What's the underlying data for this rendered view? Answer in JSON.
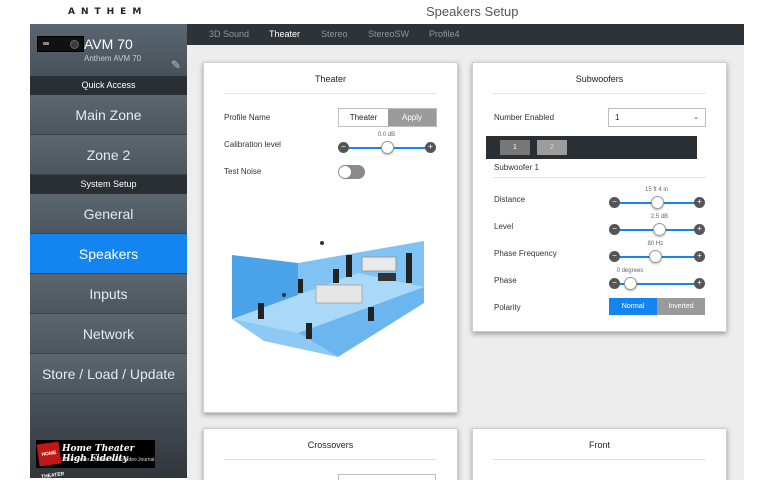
{
  "header": {
    "brand": "ANTHEM",
    "title": "Speakers Setup"
  },
  "sidebar": {
    "device_name": "AVM 70",
    "device_sub": "Anthem AVM 70",
    "quick_access_label": "Quick Access",
    "system_setup_label": "System Setup",
    "quick_items": [
      {
        "label": "Main Zone"
      },
      {
        "label": "Zone 2"
      }
    ],
    "setup_items": [
      {
        "label": "General"
      },
      {
        "label": "Speakers",
        "active": true
      },
      {
        "label": "Inputs"
      },
      {
        "label": "Network"
      },
      {
        "label": "Store / Load / Update"
      }
    ],
    "watermark": {
      "badge": "HOME THEATER",
      "title": "Home Theater High Fidelity",
      "subtitle": "The Premier On-Line Audio/Video Journal"
    }
  },
  "tabs": [
    {
      "label": "3D Sound"
    },
    {
      "label": "Theater",
      "active": true
    },
    {
      "label": "Stereo"
    },
    {
      "label": "StereoSW"
    },
    {
      "label": "Profile4"
    }
  ],
  "theater": {
    "title": "Theater",
    "profile_label": "Profile Name",
    "profile_value": "Theater",
    "apply_label": "Apply",
    "calibration_label": "Calibration level",
    "calibration_value": "0.0 dB",
    "calibration_fraction": 0.5,
    "test_noise_label": "Test Noise",
    "test_noise_on": false
  },
  "subwoofers": {
    "title": "Subwoofers",
    "number_label": "Number Enabled",
    "number_value": "1",
    "sub_buttons": [
      "1",
      "2"
    ],
    "section_label": "Subwoofer 1",
    "distance_label": "Distance",
    "distance_value": "15 ft 4 in",
    "distance_fraction": 0.5,
    "level_label": "Level",
    "level_value": "2.5 dB",
    "level_fraction": 0.55,
    "phase_freq_label": "Phase Frequency",
    "phase_freq_value": "80 Hz",
    "phase_freq_fraction": 0.48,
    "phase_label": "Phase",
    "phase_value": "0 degrees",
    "phase_fraction": 0.05,
    "polarity_label": "Polarity",
    "polarity_options": [
      "Normal",
      "Inverted"
    ]
  },
  "crossovers": {
    "title": "Crossovers"
  },
  "front": {
    "title": "Front"
  },
  "colors": {
    "accent": "#1484f0",
    "sidebar": "#4a535b",
    "tabbar": "#2e3338"
  }
}
